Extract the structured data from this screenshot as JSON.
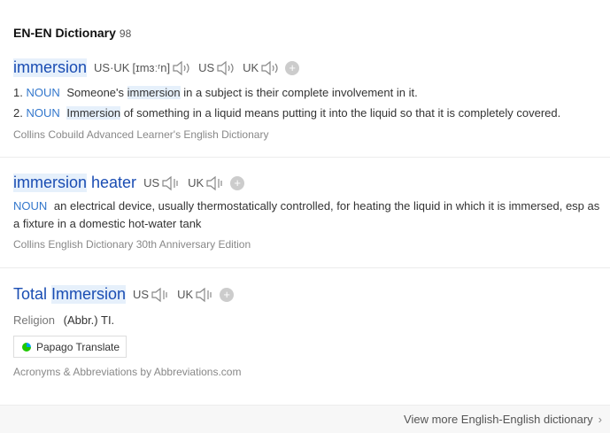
{
  "header": {
    "title": "EN-EN Dictionary",
    "count": "98"
  },
  "entry1": {
    "word": "immersion",
    "pron_label": "US·UK",
    "ipa": "[ɪmɜːʳn]",
    "us": "US",
    "uk": "UK",
    "add": "+",
    "senses": [
      {
        "num": "1.",
        "pos": "NOUN",
        "pre": "Someone's",
        "hl": "immersion",
        "post": "in a subject is their complete involvement in it."
      },
      {
        "num": "2.",
        "pos": "NOUN",
        "pre": "",
        "hl": "Immersion",
        "post": "of something in a liquid means putting it into the liquid so that it is completely covered."
      }
    ],
    "source": "Collins Cobuild Advanced Learner's English Dictionary"
  },
  "entry2": {
    "word_hl": "immersion",
    "word_rest": "heater",
    "us": "US",
    "uk": "UK",
    "add": "+",
    "pos": "NOUN",
    "def": "an electrical device, usually thermostatically controlled, for heating the liquid in which it is immersed, esp as a fixture in a domestic hot-water tank",
    "source": "Collins English Dictionary 30th Anniversary Edition"
  },
  "entry3": {
    "word_pre": "Total",
    "word_hl": "Immersion",
    "us": "US",
    "uk": "UK",
    "add": "+",
    "domain": "Religion",
    "abbr": "(Abbr.) TI.",
    "papago": "Papago Translate",
    "source": "Acronyms & Abbreviations by Abbreviations.com"
  },
  "footer": {
    "more": "View more English-English dictionary",
    "chev": "›"
  }
}
